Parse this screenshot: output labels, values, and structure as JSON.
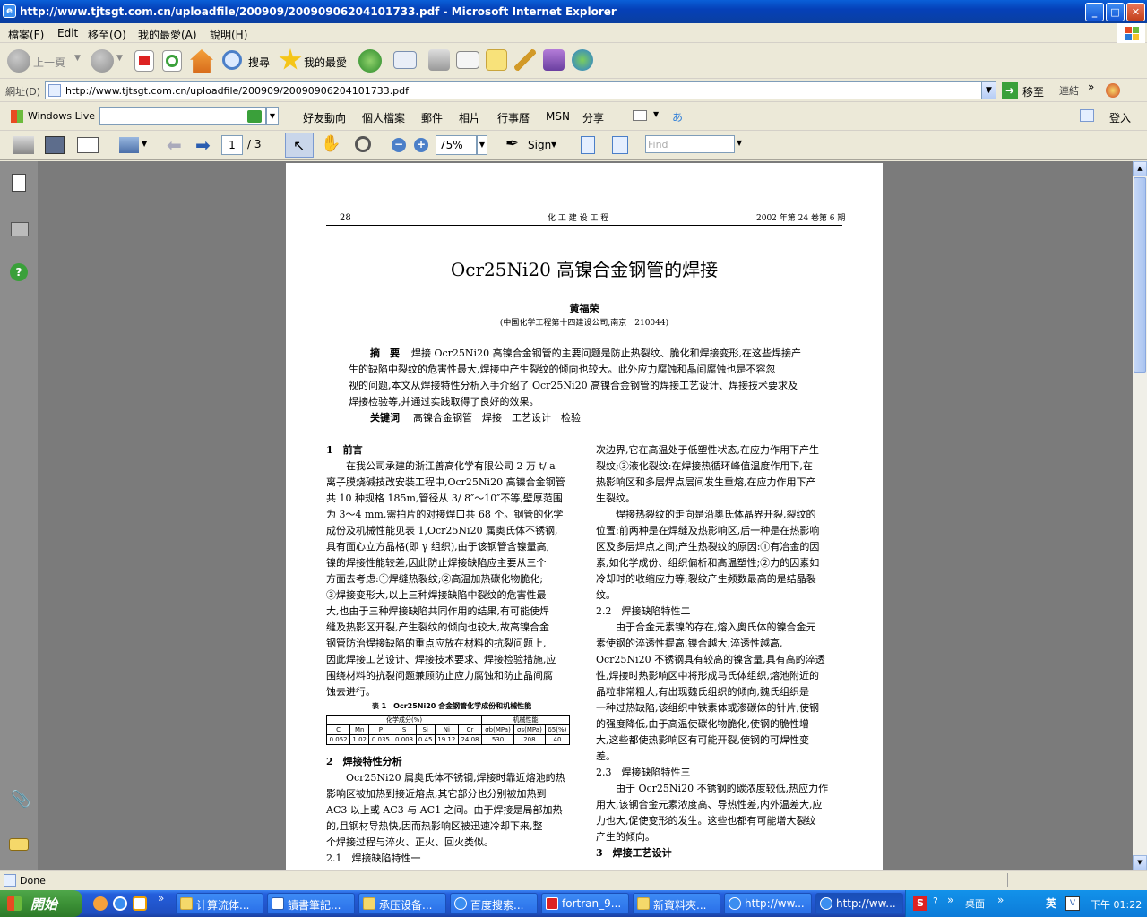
{
  "window": {
    "title": "http://www.tjtsgt.com.cn/uploadfile/200909/20090906204101733.pdf - Microsoft Internet Explorer",
    "min": "_",
    "max": "□",
    "close": "✕"
  },
  "menu": [
    "檔案(F)",
    "Edit",
    "移至(O)",
    "我的最愛(A)",
    "說明(H)"
  ],
  "stdbar": {
    "back": "上一頁",
    "search": "搜尋",
    "favorites": "我的最愛"
  },
  "address": {
    "label": "網址(D)",
    "url": "http://www.tjtsgt.com.cn/uploadfile/200909/20090906204101733.pdf",
    "go": "移至",
    "links": "連結"
  },
  "live": {
    "brand": "Windows Live",
    "items": [
      "好友動向",
      "個人檔案",
      "郵件",
      "相片",
      "行事曆",
      "MSN",
      "分享"
    ],
    "signin": "登入"
  },
  "pdf": {
    "page_current": "1",
    "page_total": "/ 3",
    "zoom": "75%",
    "sign": "Sign",
    "find_placeholder": "Find"
  },
  "doc": {
    "header_left": "28",
    "header_center": "化 工 建 设 工 程",
    "header_right": "2002 年第 24 卷第 6 期",
    "title": "Ocr25Ni20 高镍合金钢管的焊接",
    "author": "黄福荣",
    "affiliation": "(中国化学工程第十四建设公司,南京　210044)",
    "abstract_label": "摘　要",
    "abstract_lines": [
      "焊接 Ocr25Ni20 高镍合金钢管的主要问题是防止热裂纹、脆化和焊接变形,在这些焊接产",
      "生的缺陷中裂纹的危害性最大,焊接中产生裂纹的倾向也较大。此外应力腐蚀和晶间腐蚀也是不容忽",
      "视的问题,本文从焊接特性分析入手介绍了 Ocr25Ni20 高镍合金钢管的焊接工艺设计、焊接技术要求及",
      "焊接检验等,并通过实践取得了良好的效果。"
    ],
    "keywords_label": "关键词",
    "keywords": "高镍合金钢管　焊接　工艺设计　检验",
    "left_col": [
      {
        "t": "1　前言",
        "b": true
      },
      {
        "t": "　　在我公司承建的浙江善高化学有限公司 2 万 t/ a"
      },
      {
        "t": "离子膜烧碱技改安装工程中,Ocr25Ni20 高镍合金钢管"
      },
      {
        "t": "共 10 种规格 185m,管径从 3/ 8″～10″不等,壁厚范围"
      },
      {
        "t": "为 3～4 mm,需拍片的对接焊口共 68 个。钢管的化学"
      },
      {
        "t": "成份及机械性能见表 1,Ocr25Ni20 属奥氏体不锈钢,"
      },
      {
        "t": "具有面心立方晶格(即 γ 组织),由于该钢管含镍量高,"
      },
      {
        "t": "镍的焊接性能较差,因此防止焊接缺陷应主要从三个"
      },
      {
        "t": "方面去考虑:①焊缝热裂纹;②高温加热碳化物脆化;"
      },
      {
        "t": "③焊接变形大,以上三种焊接缺陷中裂纹的危害性最"
      },
      {
        "t": "大,也由于三种焊接缺陷共同作用的结果,有可能使焊"
      },
      {
        "t": "缝及热影区开裂,产生裂纹的倾向也较大,故高镍合金"
      },
      {
        "t": "钢管防治焊接缺陷的重点应放在材料的抗裂问题上,"
      },
      {
        "t": "因此焊接工艺设计、焊接技术要求、焊接检验措施,应"
      },
      {
        "t": "围绕材料的抗裂问题兼顾防止应力腐蚀和防止晶间腐"
      },
      {
        "t": "蚀去进行。"
      }
    ],
    "table_caption": "表 1　Ocr25Ni20 合金钢管化学成份和机械性能",
    "table_group1": "化学成分(%)",
    "table_group2": "机械性能",
    "table_headers": [
      "C",
      "Mn",
      "P",
      "S",
      "Si",
      "Ni",
      "Cr",
      "σb(MPa)",
      "σs(MPa)",
      "δ5(%)"
    ],
    "table_values": [
      "0.052",
      "1.02",
      "0.035",
      "0.003",
      "0.45",
      "19.12",
      "24.08",
      "530",
      "208",
      "40"
    ],
    "left_col2": [
      {
        "t": "2　焊接特性分析",
        "b": true
      },
      {
        "t": "　　Ocr25Ni20 属奥氏体不锈钢,焊接时靠近熔池的热"
      },
      {
        "t": "影响区被加热到接近熔点,其它部分也分别被加热到"
      },
      {
        "t": "AC3 以上或 AC3 与 AC1 之间。由于焊接是局部加热"
      },
      {
        "t": "的,且钢材导热快,因而热影响区被迅速冷却下来,整"
      },
      {
        "t": "个焊接过程与淬火、正火、回火类似。"
      },
      {
        "t": "2.1　焊接缺陷特性一"
      }
    ],
    "right_col": [
      {
        "t": "次边界,它在高温处于低塑性状态,在应力作用下产生"
      },
      {
        "t": "裂纹;③液化裂纹:在焊接热循环峰值温度作用下,在"
      },
      {
        "t": "热影响区和多层焊点层间发生重熔,在应力作用下产"
      },
      {
        "t": "生裂纹。"
      },
      {
        "t": "　　焊接热裂纹的走向是沿奥氏体晶界开裂,裂纹的"
      },
      {
        "t": "位置:前两种是在焊缝及热影响区,后一种是在热影响"
      },
      {
        "t": "区及多层焊点之间;产生热裂纹的原因:①有冶金的因"
      },
      {
        "t": "素,如化学成份、组织偏析和高温塑性;②力的因素如"
      },
      {
        "t": "冷却时的收缩应力等;裂纹产生频数最高的是结晶裂"
      },
      {
        "t": "纹。"
      },
      {
        "t": "2.2　焊接缺陷特性二"
      },
      {
        "t": "　　由于合金元素镍的存在,熔入奥氏体的镍合金元"
      },
      {
        "t": "素使钢的淬透性提高,镍合越大,淬透性越高,"
      },
      {
        "t": "Ocr25Ni20 不锈钢具有较高的镍含量,具有高的淬透"
      },
      {
        "t": "性,焊接时热影响区中将形成马氏体组织,熔池附近的"
      },
      {
        "t": "晶粒非常粗大,有出现魏氏组织的倾向,魏氏组织是"
      },
      {
        "t": "一种过热缺陷,该组织中铁素体或渗碳体的针片,使钢"
      },
      {
        "t": "的强度降低,由于高温使碳化物脆化,使钢的脆性增"
      },
      {
        "t": "大,这些都使热影响区有可能开裂,使钢的可焊性变"
      },
      {
        "t": "差。"
      },
      {
        "t": "2.3　焊接缺陷特性三"
      },
      {
        "t": "　　由于 Ocr25Ni20 不锈钢的碳浓度较低,热应力作"
      },
      {
        "t": "用大,该钢合金元素浓度高、导热性差,内外温差大,应"
      },
      {
        "t": "力也大,促使变形的发生。这些也都有可能增大裂纹"
      },
      {
        "t": "产生的倾向。"
      },
      {
        "t": "3　焊接工艺设计",
        "b": true
      }
    ]
  },
  "status": {
    "text": "Done"
  },
  "taskbar": {
    "start": "開始",
    "tasks": [
      "计算流体...",
      "讀書筆記...",
      "承压设备...",
      "百度搜索...",
      "fortran_9...",
      "新資料夾...",
      "http://ww...",
      "http://ww..."
    ],
    "tray_desktop": "桌面",
    "tray_lang": "英",
    "clock": "下午 01:22"
  }
}
